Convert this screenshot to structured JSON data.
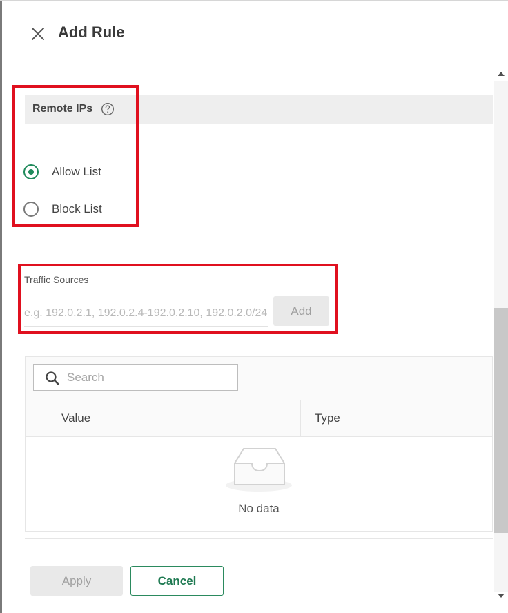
{
  "header": {
    "title": "Add Rule",
    "close_icon": "close-icon"
  },
  "remote_ips": {
    "label": "Remote IPs",
    "help_icon": "help-circle-icon",
    "options": [
      {
        "label": "Allow List",
        "checked": true
      },
      {
        "label": "Block List",
        "checked": false
      }
    ]
  },
  "traffic_sources": {
    "label": "Traffic Sources",
    "placeholder": "e.g. 192.0.2.1, 192.0.2.4-192.0.2.10, 192.0.2.0/24",
    "value": "",
    "add_label": "Add"
  },
  "table": {
    "search_placeholder": "Search",
    "columns": [
      "Value",
      "Type"
    ],
    "rows": [],
    "empty_text": "No data"
  },
  "footer": {
    "apply_label": "Apply",
    "cancel_label": "Cancel"
  },
  "colors": {
    "accent": "#1f8a5b",
    "highlight": "#e0101f"
  }
}
